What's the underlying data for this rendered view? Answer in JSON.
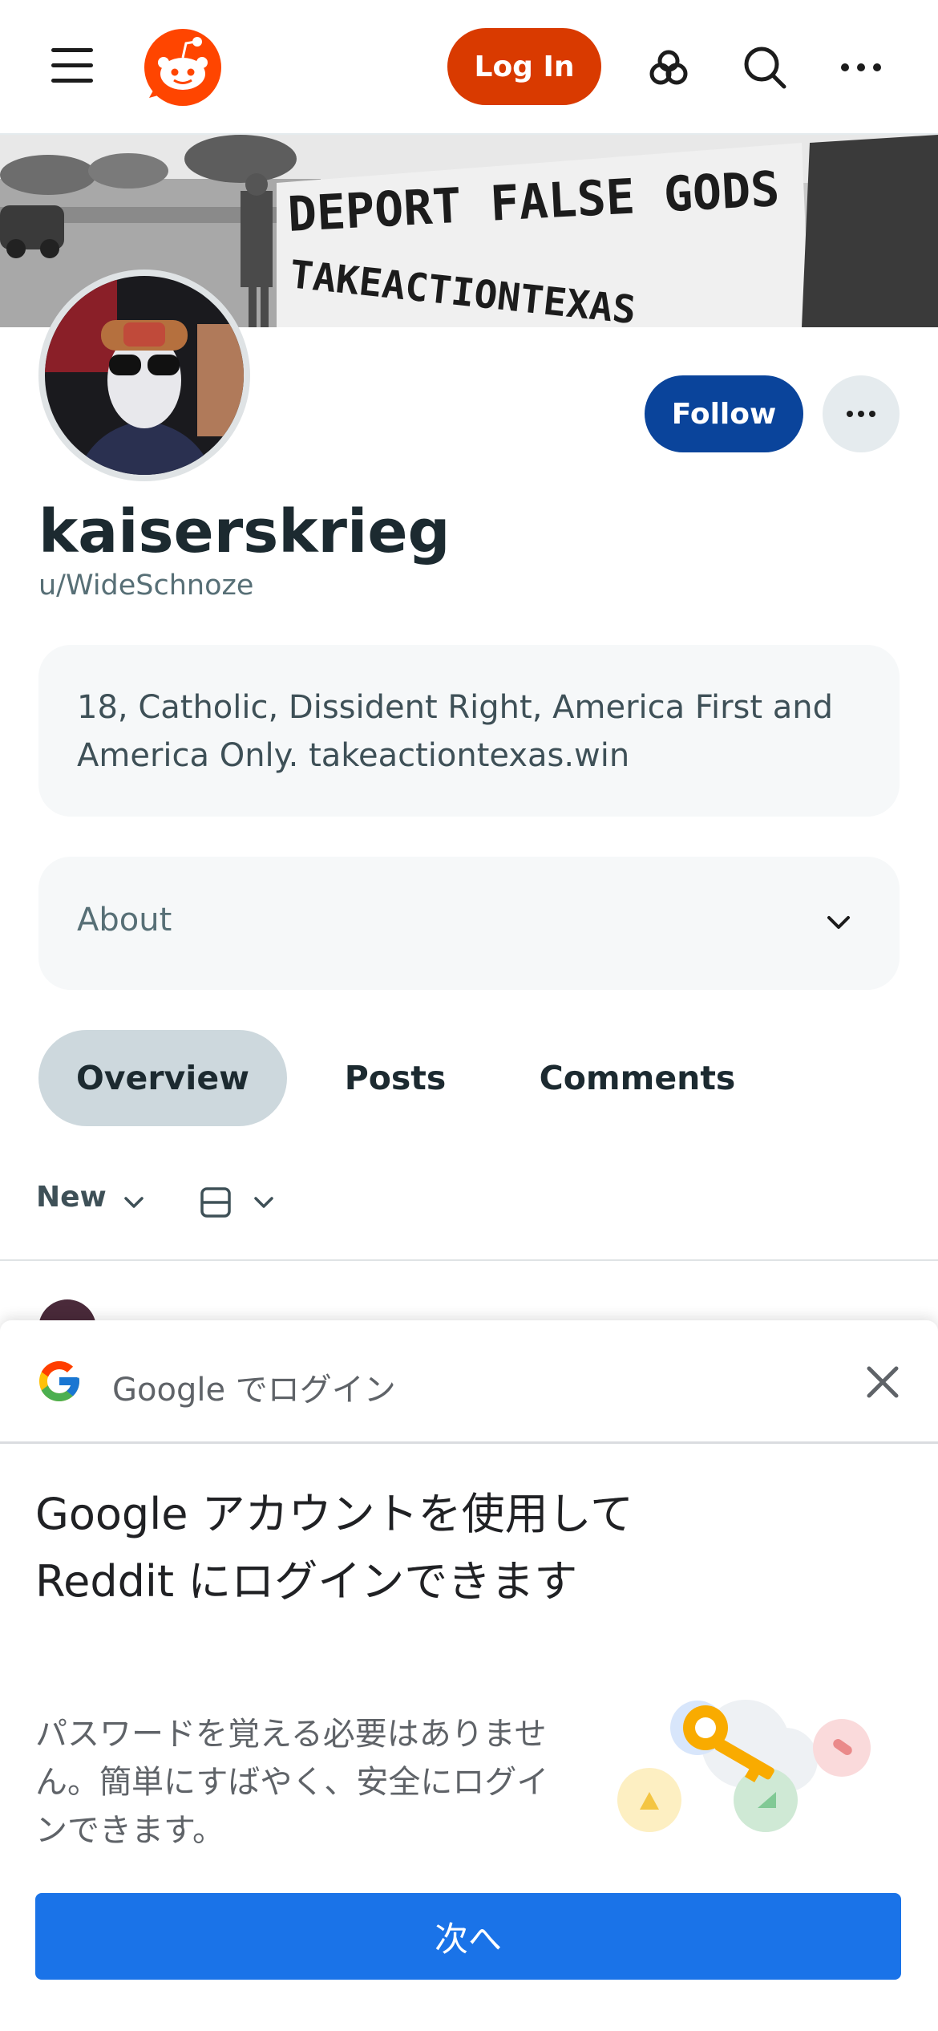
{
  "header": {
    "login_label": "Log In",
    "icons": [
      "menu-icon",
      "reddit-logo",
      "advertise-icon",
      "search-icon",
      "more-icon"
    ]
  },
  "banner": {
    "sign_line1": "DEPORT FALSE GODS",
    "sign_line2": "TAKEACTIONTEXAS"
  },
  "profile": {
    "display_name": "kaiserskrieg",
    "username": "u/WideSchnoze",
    "follow_label": "Follow",
    "bio": "18, Catholic, Dissident Right, America First and America Only. takeactiontexas.win",
    "about_label": "About"
  },
  "tabs": [
    {
      "label": "Overview",
      "active": true
    },
    {
      "label": "Posts",
      "active": false
    },
    {
      "label": "Comments",
      "active": false
    }
  ],
  "feed_controls": {
    "sort_label": "New"
  },
  "google_prompt": {
    "title": "Google でログイン",
    "heading": "Google アカウントを使用して Reddit にログインできます",
    "body": "パスワードを覚える必要はありません。簡単にすばやく、安全にログインできます。",
    "next_label": "次へ"
  },
  "colors": {
    "reddit_orange": "#d93a00",
    "follow_blue": "#0a449b",
    "google_blue": "#1a73e8",
    "tab_active_bg": "#cdd8dd"
  }
}
